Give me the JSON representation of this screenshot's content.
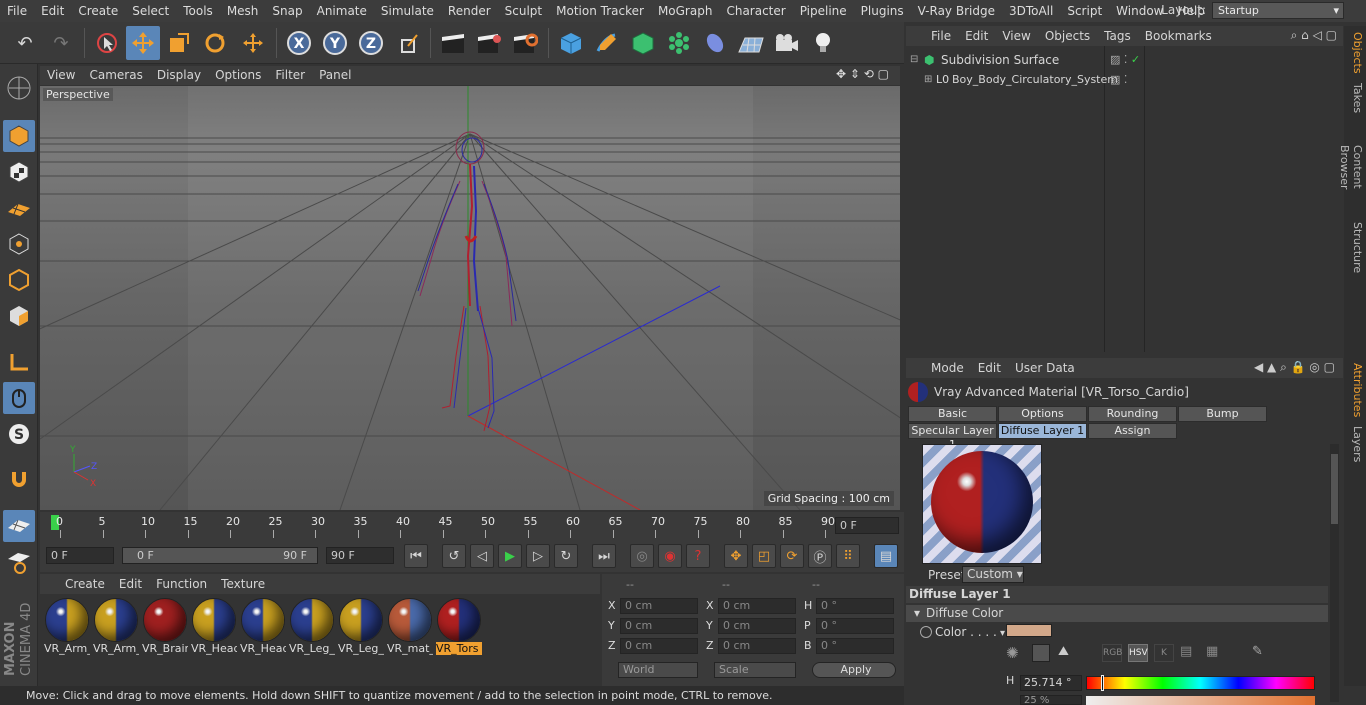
{
  "menu": [
    "File",
    "Edit",
    "Create",
    "Select",
    "Tools",
    "Mesh",
    "Snap",
    "Animate",
    "Simulate",
    "Render",
    "Sculpt",
    "Motion Tracker",
    "MoGraph",
    "Character",
    "Pipeline",
    "Plugins",
    "V-Ray Bridge",
    "3DToAll",
    "Script",
    "Window",
    "Help"
  ],
  "layout": {
    "label": "Layout:",
    "value": "Startup"
  },
  "viewport": {
    "menu": [
      "View",
      "Cameras",
      "Display",
      "Options",
      "Filter",
      "Panel"
    ],
    "label": "Perspective",
    "grid_spacing": "Grid Spacing : 100 cm"
  },
  "timeline": {
    "ticks": [
      "0",
      "5",
      "10",
      "15",
      "20",
      "25",
      "30",
      "35",
      "40",
      "45",
      "50",
      "55",
      "60",
      "65",
      "70",
      "75",
      "80",
      "85",
      "90"
    ],
    "current_frame": "0 F",
    "start": "0 F",
    "range_start": "0 F",
    "range_end": "90 F",
    "end": "90 F"
  },
  "materials": {
    "menu": [
      "Create",
      "Edit",
      "Function",
      "Texture"
    ],
    "items": [
      {
        "name": "VR_Arm_",
        "left": "#2b3f8f",
        "right": "#c9a020"
      },
      {
        "name": "VR_Arm_",
        "left": "#c9a020",
        "right": "#2b3f8f"
      },
      {
        "name": "VR_Brair",
        "left": "#a02020",
        "right": "#a02020"
      },
      {
        "name": "VR_Head",
        "left": "#c9a020",
        "right": "#2b3f8f"
      },
      {
        "name": "VR_Head",
        "left": "#2b3f8f",
        "right": "#c9a020"
      },
      {
        "name": "VR_Leg_",
        "left": "#2b3f8f",
        "right": "#c9a020"
      },
      {
        "name": "VR_Leg_",
        "left": "#c9a020",
        "right": "#2b3f8f"
      },
      {
        "name": "VR_mat_",
        "left": "#b85a3a",
        "right": "#4a6aaa"
      },
      {
        "name": "VR_Tors",
        "left": "#b02020",
        "right": "#23307a"
      }
    ]
  },
  "coords": {
    "headers": [
      "--",
      "--",
      "--"
    ],
    "pos": [
      {
        "axis": "X",
        "value": "0 cm"
      },
      {
        "axis": "Y",
        "value": "0 cm"
      },
      {
        "axis": "Z",
        "value": "0 cm"
      }
    ],
    "size": [
      {
        "axis": "X",
        "value": "0 cm"
      },
      {
        "axis": "Y",
        "value": "0 cm"
      },
      {
        "axis": "Z",
        "value": "0 cm"
      }
    ],
    "rot": [
      {
        "axis": "H",
        "value": "0 °"
      },
      {
        "axis": "P",
        "value": "0 °"
      },
      {
        "axis": "B",
        "value": "0 °"
      }
    ],
    "mode": "World",
    "transform": "Scale",
    "apply": "Apply"
  },
  "status": "Move: Click and drag to move elements. Hold down SHIFT to quantize movement / add to the selection in point mode, CTRL to remove.",
  "objects": {
    "menu": [
      "File",
      "Edit",
      "View",
      "Objects",
      "Tags",
      "Bookmarks"
    ],
    "rows": [
      {
        "name": "Subdivision Surface"
      },
      {
        "name": "Boy_Body_Circulatory_System"
      }
    ]
  },
  "side_tabs_top": [
    "Objects",
    "Takes",
    "Content Browser",
    "Structure"
  ],
  "side_tabs_bottom": [
    "Attributes",
    "Layers"
  ],
  "attributes": {
    "menu": [
      "Mode",
      "Edit",
      "User Data"
    ],
    "title": "Vray Advanced Material [VR_Torso_Cardio]",
    "tabs_row1": [
      "Basic",
      "Options",
      "Rounding",
      "Bump"
    ],
    "tabs_row2": [
      "Specular Layer 1",
      "Diffuse Layer 1",
      "Assign"
    ],
    "active_tab": "Diffuse Layer 1",
    "preset_label": "Preset",
    "preset_value": "Custom",
    "section": "Diffuse Layer 1",
    "subsection": "Diffuse Color",
    "color_label": "Color . . . .",
    "color_value": "#d2a88a",
    "color_modes": [
      "RGB",
      "HSV",
      "K"
    ],
    "h_label": "H",
    "h_value": "25.714 °",
    "s_value": "25 %"
  },
  "colors": {
    "accent": "#5a86b8",
    "selected_mat": "#f0a030"
  }
}
